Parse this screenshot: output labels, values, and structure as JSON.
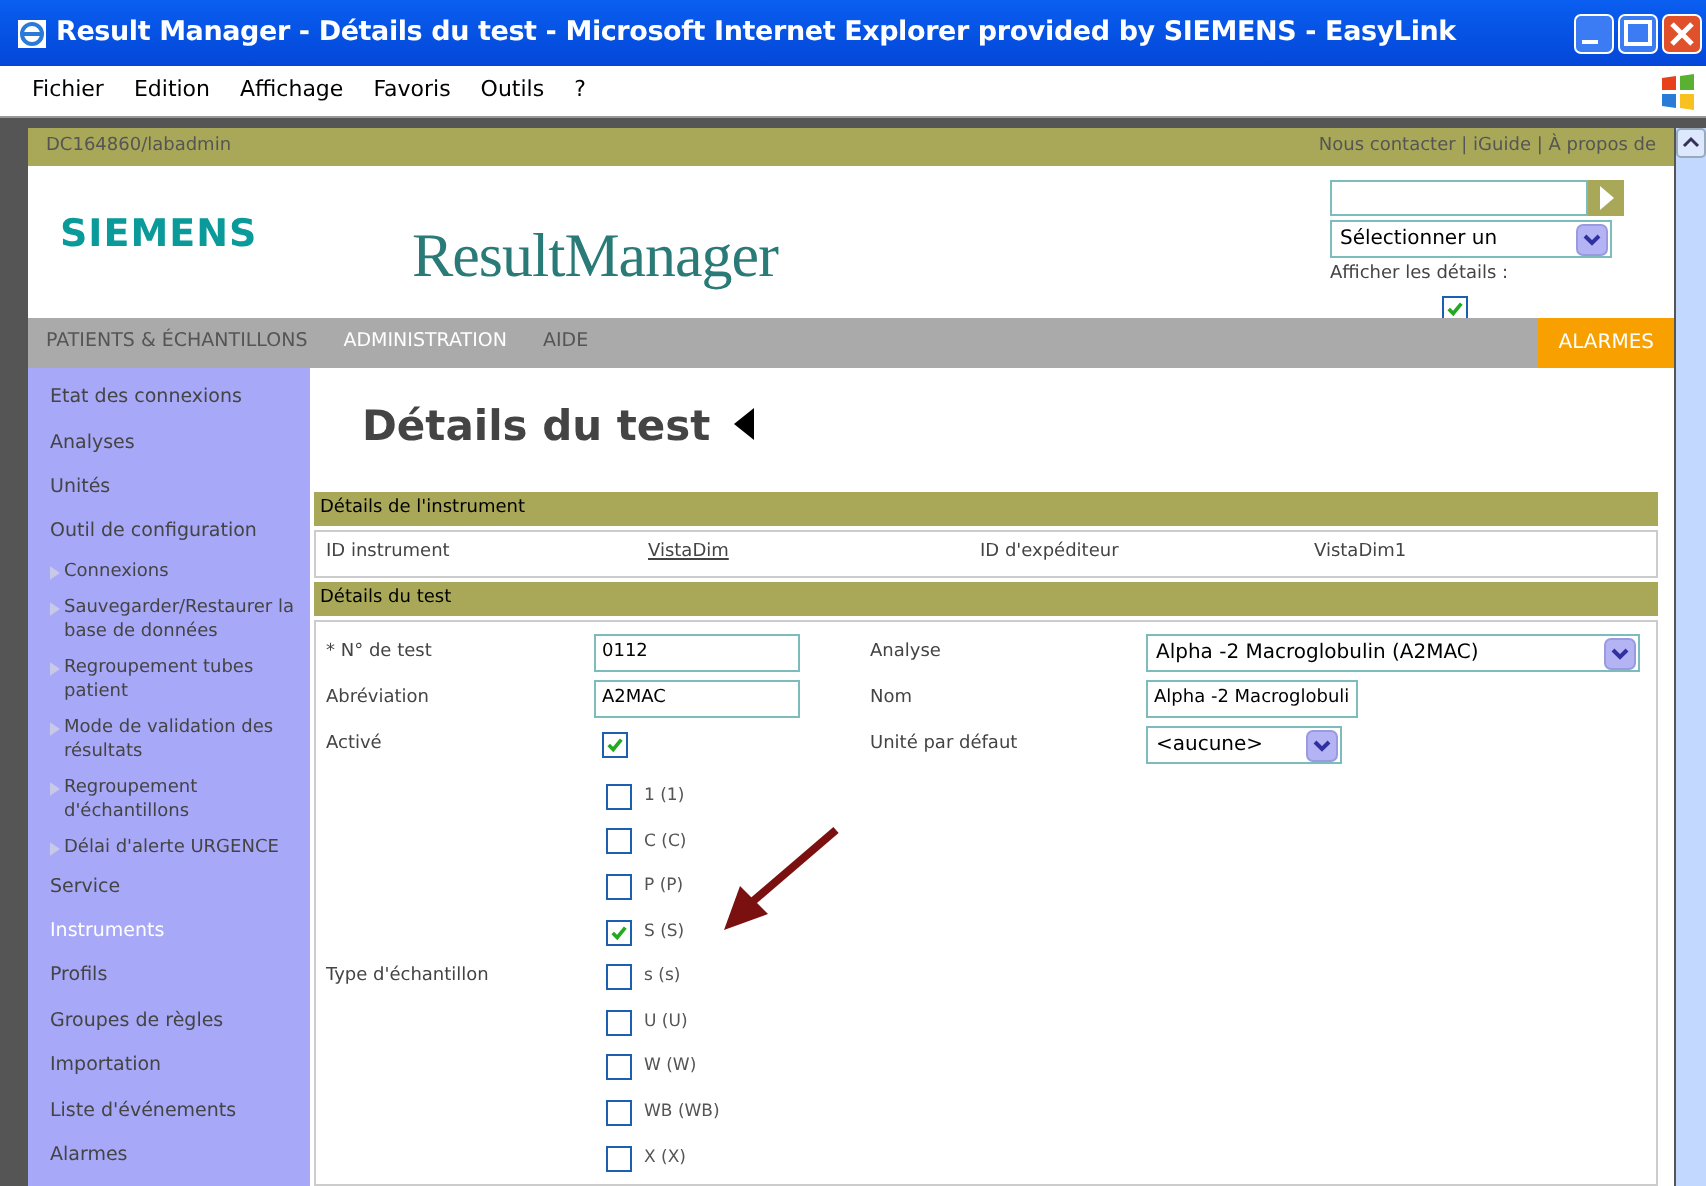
{
  "window": {
    "title": "Result Manager - Détails du test - Microsoft Internet Explorer provided by SIEMENS - EasyLink"
  },
  "menu": [
    "Fichier",
    "Edition",
    "Affichage",
    "Favoris",
    "Outils",
    "?"
  ],
  "top_bar": {
    "user": "DC164860/labadmin",
    "links": "Nous contacter | iGuide | À propos de"
  },
  "header": {
    "logo": "SIEMENS",
    "app_title": "ResultManager",
    "select": "Sélectionner un",
    "show_details": {
      "label": "Afficher les détails :",
      "checked": true
    }
  },
  "nav": [
    {
      "label": "PATIENTS & ÉCHANTILLONS",
      "selected": false
    },
    {
      "label": "ADMINISTRATION",
      "selected": true
    },
    {
      "label": "AIDE",
      "selected": false
    }
  ],
  "alarm_button": "ALARMES",
  "sidebar": [
    {
      "label": "Etat des connexions",
      "kind": "item",
      "selected": false
    },
    {
      "label": "Analyses",
      "kind": "item",
      "selected": false
    },
    {
      "label": "Unités",
      "kind": "item",
      "selected": false
    },
    {
      "label": "Outil de configuration",
      "kind": "item",
      "selected": false
    },
    {
      "label": "Connexions",
      "kind": "sub",
      "selected": false
    },
    {
      "label": "Sauvegarder/Restaurer la base de données",
      "kind": "sub",
      "selected": false
    },
    {
      "label": "Regroupement tubes patient",
      "kind": "sub",
      "selected": false
    },
    {
      "label": "Mode de validation des résultats",
      "kind": "sub",
      "selected": false
    },
    {
      "label": "Regroupement d'échantillons",
      "kind": "sub",
      "selected": false
    },
    {
      "label": "Délai d'alerte URGENCE",
      "kind": "sub",
      "selected": false
    },
    {
      "label": "Service",
      "kind": "item",
      "selected": false
    },
    {
      "label": "Instruments",
      "kind": "item",
      "selected": true
    },
    {
      "label": "Profils",
      "kind": "item",
      "selected": false
    },
    {
      "label": "Groupes de règles",
      "kind": "item",
      "selected": false
    },
    {
      "label": "Importation",
      "kind": "item",
      "selected": false
    },
    {
      "label": "Liste d'événements",
      "kind": "item",
      "selected": false
    },
    {
      "label": "Alarmes",
      "kind": "item",
      "selected": false
    }
  ],
  "page_title": "Détails du test",
  "instrument_section": {
    "title": "Détails de l'instrument",
    "instrument_id_label": "ID instrument",
    "instrument_id": "VistaDim",
    "sender_id_label": "ID d'expéditeur",
    "sender_id": "VistaDim1"
  },
  "test_section": {
    "title": "Détails du test",
    "rows": [
      {
        "fields": [
          {
            "label": "* N° de test",
            "kind": "input",
            "value": "0112"
          },
          {
            "label": "Analyse",
            "kind": "select",
            "value": "Alpha -2 Macroglobulin (A2MAC)"
          }
        ]
      },
      {
        "fields": [
          {
            "label": "Abréviation",
            "kind": "input",
            "value": "A2MAC"
          },
          {
            "label": "Nom",
            "kind": "input",
            "value": "Alpha -2 Macroglobuli"
          }
        ]
      },
      {
        "fields": [
          {
            "label": "Activé",
            "kind": "checkbox",
            "checked": true
          },
          {
            "label": "Unité par défaut",
            "kind": "select",
            "value": "<aucune>"
          }
        ]
      }
    ],
    "sample_type_label": "Type d'échantillon",
    "sample_types": [
      {
        "label": "1 (1)",
        "checked": false
      },
      {
        "label": "C (C)",
        "checked": false
      },
      {
        "label": "P (P)",
        "checked": false
      },
      {
        "label": "S (S)",
        "checked": true
      },
      {
        "label": "s (s)",
        "checked": false
      },
      {
        "label": "U (U)",
        "checked": false
      },
      {
        "label": "W (W)",
        "checked": false
      },
      {
        "label": "WB (WB)",
        "checked": false
      },
      {
        "label": "X (X)",
        "checked": false
      }
    ]
  }
}
